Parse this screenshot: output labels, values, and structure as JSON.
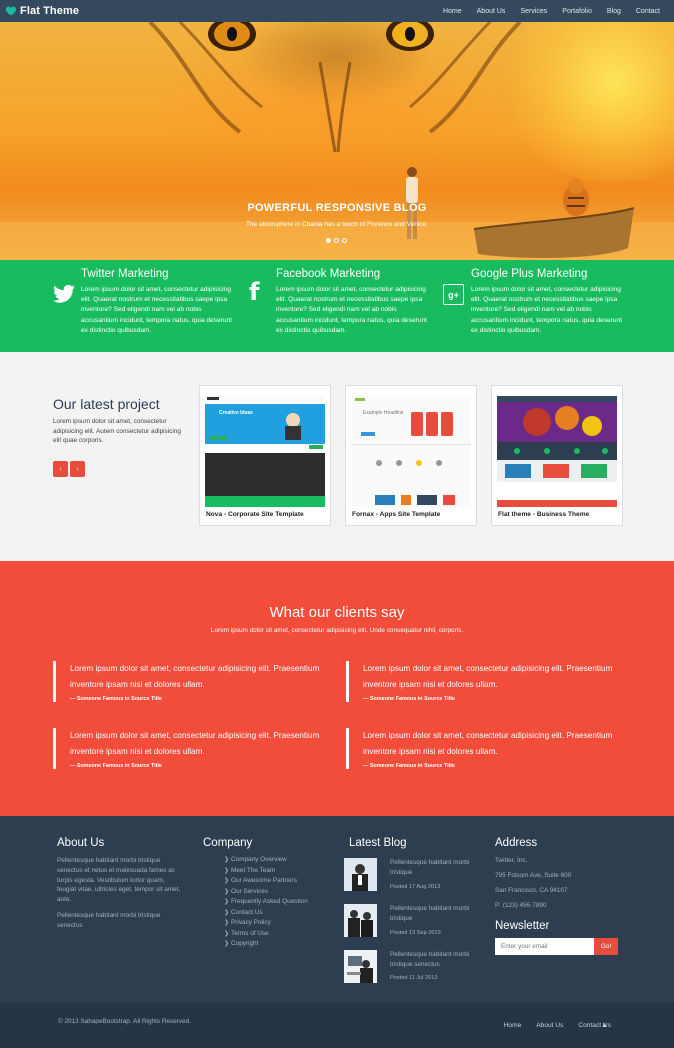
{
  "navbar": {
    "brand": "Flat Theme",
    "items": [
      "Home",
      "About Us",
      "Services",
      "Portafolio",
      "Blog",
      "Contact"
    ]
  },
  "hero": {
    "title": "POWERFUL RESPONSIVE BLOG",
    "subtitle": "The atmosphere in Chania has a touch of Florence and Venice.",
    "slide_count": 3,
    "active_slide": 1
  },
  "services": [
    {
      "icon": "twitter-icon",
      "title": "Twitter Marketing",
      "text": "Lorem ipsum dolor sit amet, consectetur adipisicing elit. Quaerat nostrum et necessitatibus saepe ipsa inventore? Sed eligendi nam vel ab nobis accusantium incidunt, tempora natus, quia deserunt ex distinctio quibusdam."
    },
    {
      "icon": "facebook-icon",
      "title": "Facebook Marketing",
      "text": "Lorem ipsum dolor sit amet, consectetur adipisicing elit. Quaerat nostrum et necessitatibus saepe ipsa inventore? Sed eligendi nam vel ab nobis accusantium incidunt, tempora natus, quia deserunt ex distinctio quibusdam."
    },
    {
      "icon": "google-plus-icon",
      "title": "Google Plus Marketing",
      "text": "Lorem ipsum dolor sit amet, consectetur adipisicing elit. Quaerat nostrum et necessitatibus saepe ipsa inventore? Sed eligendi nam vel ab nobis accusantium incidunt, tempora natus, quia deserunt ex distinctio quibusdam."
    }
  ],
  "projects": {
    "title": "Our latest project",
    "text": "Lorem ipsum dolor sit amet, consectetur adipisicing elit. Autem consectetur adipisicing elit quae corporis.",
    "prev_label": "‹",
    "next_label": "›",
    "items": [
      {
        "label": "Nova - Corporate Site Template",
        "mini_heading": "Creative Ideas"
      },
      {
        "label": "Fornax - Apps Site Template",
        "mini_heading": "Example Headline"
      },
      {
        "label": "Flat theme - Business Theme",
        "mini_heading": ""
      }
    ]
  },
  "testimonials": {
    "title": "What our clients say",
    "subtitle": "Lorem ipsum dolor sit amet, consectetur adipisicing elit. Unde consequatur nihil, corporis.",
    "items": [
      {
        "text": "Lorem ipsum dolor sit amet, consectetur adipisicing elit. Praesentium inventore ipsam nisi et dolores ullam.",
        "source": "— Someone Famous in Source Title"
      },
      {
        "text": "Lorem ipsum dolor sit amet, consectetur adipisicing elit. Praesentium inventore ipsam nisi et dolores ullam.",
        "source": "— Someone Famous in Source Title"
      },
      {
        "text": "Lorem ipsum dolor sit amet, consectetur adipisicing elit. Praesentium inventore ipsam nisi et dolores ullam.",
        "source": "— Someone Famous in Source Title"
      },
      {
        "text": "Lorem ipsum dolor sit amet, consectetur adipisicing elit. Praesentium inventore ipsam nisi et dolores ullam.",
        "source": "— Someone Famous in Source Title"
      }
    ]
  },
  "footer": {
    "about": {
      "title": "About Us",
      "p1": "Pellentesque habitant morbi tristique senectus et netus et malesuada fames ac turpis egesta. Vestibulum tortor quam, feugiat vitae, ultricies eget, tempor sit amet, ante.",
      "p2": "Pellentesque habitant morbi tristique senectus"
    },
    "company": {
      "title": "Company",
      "links": [
        "Company Overview",
        "Meet The Team",
        "Our Awesome Partners",
        "Our Services",
        "Frequently Asked Question",
        "Contact Us",
        "Privacy Policy",
        "Terms of Use",
        "Copyright"
      ]
    },
    "blog": {
      "title": "Latest Blog",
      "posts": [
        {
          "title": "Pellentesque habitant morbi tristique",
          "date": "Posted 17 Aug 2013"
        },
        {
          "title": "Pellentesque habitant morbi tristique",
          "date": "Posted 13 Sep 2013"
        },
        {
          "title": "Pellentesque habitant morbi tristique senectus",
          "date": "Posted 11 Jul 2013"
        }
      ]
    },
    "address": {
      "title": "Address",
      "company": "Twitter, Inc.",
      "line1": "795 Folsom Ave, Suite 600",
      "line2": "San Francisco, CA 94107",
      "phone": "P: (123) 456-7890"
    },
    "newsletter": {
      "title": "Newsletter",
      "placeholder": "Enter your email",
      "button": "Go!"
    }
  },
  "bottombar": {
    "copyright": "© 2013 SahapeBootstrap. All Rights Reserved.",
    "links": [
      "Home",
      "About Us",
      "Contact Us"
    ],
    "up_icon": "chevron-up-icon"
  },
  "colors": {
    "navbar": "#34495e",
    "green": "#18bc5e",
    "red": "#f24c3b",
    "footer": "#2c3e50",
    "accent_heart": "#1abc9c"
  }
}
